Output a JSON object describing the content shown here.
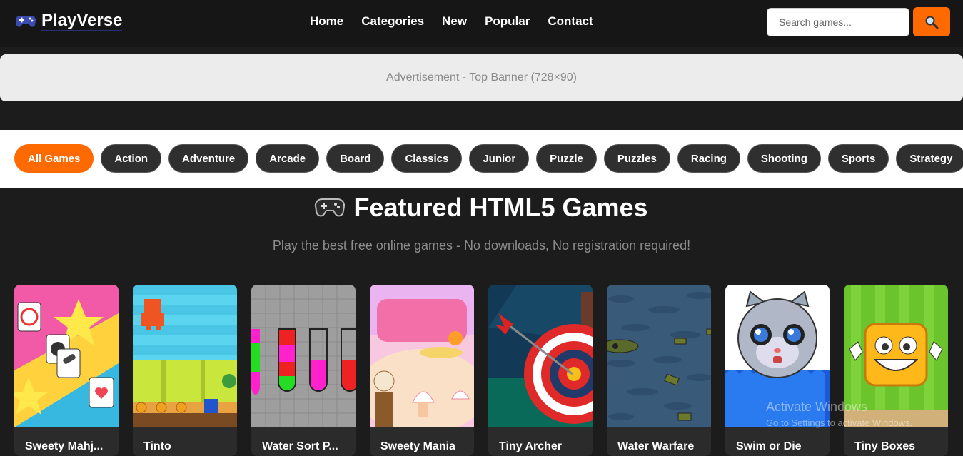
{
  "header": {
    "logo_text": "PlayVerse",
    "nav": [
      "Home",
      "Categories",
      "New",
      "Popular",
      "Contact"
    ],
    "search_placeholder": "Search games...",
    "accent": "#ff6a00"
  },
  "ad": {
    "text": "Advertisement - Top Banner (728×90)"
  },
  "categories": [
    "All Games",
    "Action",
    "Adventure",
    "Arcade",
    "Board",
    "Classics",
    "Junior",
    "Puzzle",
    "Puzzles",
    "Racing",
    "Shooting",
    "Sports",
    "Strategy"
  ],
  "active_category": "All Games",
  "section": {
    "title": "Featured HTML5 Games",
    "subtitle": "Play the best free online games - No downloads, No registration required!"
  },
  "games": [
    {
      "title": "Sweety Mahj..."
    },
    {
      "title": "Tinto"
    },
    {
      "title": "Water Sort P..."
    },
    {
      "title": "Sweety Mania"
    },
    {
      "title": "Tiny Archer"
    },
    {
      "title": "Water Warfare"
    },
    {
      "title": "Swim or Die"
    },
    {
      "title": "Tiny Boxes"
    }
  ],
  "watermark": {
    "line1": "Activate Windows",
    "line2": "Go to Settings to activate Windows."
  }
}
